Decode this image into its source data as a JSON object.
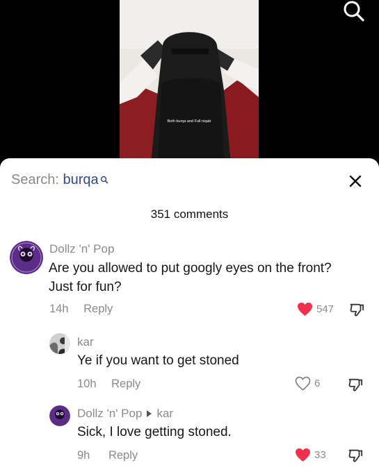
{
  "video": {
    "caption": "Both burqa and Full niqab"
  },
  "search": {
    "prefix": "Search: ",
    "query": "burqa"
  },
  "comments_header": {
    "count_label": "351 comments"
  },
  "comments": [
    {
      "author": "Dollz 'n' Pop",
      "text_line1": "Are you allowed to put googly eyes on the front?",
      "text_line2": "Just for fun?",
      "time": "14h",
      "reply_label": "Reply",
      "likes": "547",
      "liked": true,
      "avatar_text": "Dollz 'n' Pop"
    },
    {
      "author": "kar",
      "text_line1": "Ye if you want to get stoned",
      "time": "10h",
      "reply_label": "Reply",
      "likes": "6",
      "liked": false
    },
    {
      "author": "Dollz 'n' Pop",
      "reply_to": "kar",
      "text_line1": "Sick, I love getting stoned.",
      "time": "9h",
      "reply_label": "Reply",
      "likes": "33",
      "liked": true
    }
  ],
  "colors": {
    "like_red": "#f0304c",
    "accent_blue": "#2f4a8a",
    "avatar_purple": "#5b2d86"
  },
  "icons": [
    "search-icon",
    "close-icon",
    "heart-icon",
    "dislike-icon",
    "reply-arrow-icon"
  ]
}
